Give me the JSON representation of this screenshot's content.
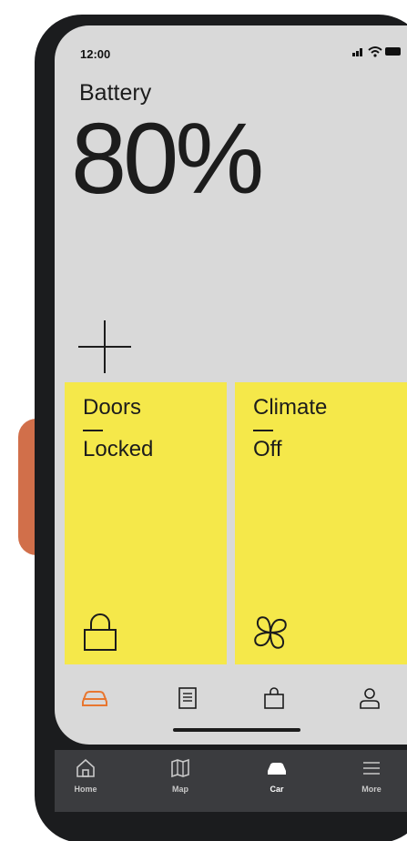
{
  "status_bar": {
    "time": "12:00",
    "icons": [
      "signal-icon",
      "wifi-icon",
      "battery-icon"
    ]
  },
  "battery": {
    "label": "Battery",
    "value": "80%"
  },
  "actions": {
    "add_icon": "plus-icon"
  },
  "tiles": [
    {
      "title": "Doors",
      "status": "Locked",
      "icon": "lock-icon"
    },
    {
      "title": "Climate",
      "status": "Off",
      "icon": "fan-icon"
    }
  ],
  "car_tabs": [
    {
      "icon": "car-icon",
      "active": true
    },
    {
      "icon": "document-icon",
      "active": false
    },
    {
      "icon": "shopping-bag-icon",
      "active": false
    },
    {
      "icon": "user-icon",
      "active": false
    }
  ],
  "bottom_nav": [
    {
      "label": "Home",
      "icon": "home-icon",
      "active": false
    },
    {
      "label": "Map",
      "icon": "map-icon",
      "active": false
    },
    {
      "label": "Car",
      "icon": "car-icon",
      "active": true
    },
    {
      "label": "More",
      "icon": "menu-icon",
      "active": false
    }
  ],
  "colors": {
    "screen_bg": "#d9d9d9",
    "tile_yellow": "#f5e84a",
    "accent_orange": "#e8762f",
    "nav_bg": "#3b3c3f",
    "device_frame": "#1b1c1e"
  }
}
